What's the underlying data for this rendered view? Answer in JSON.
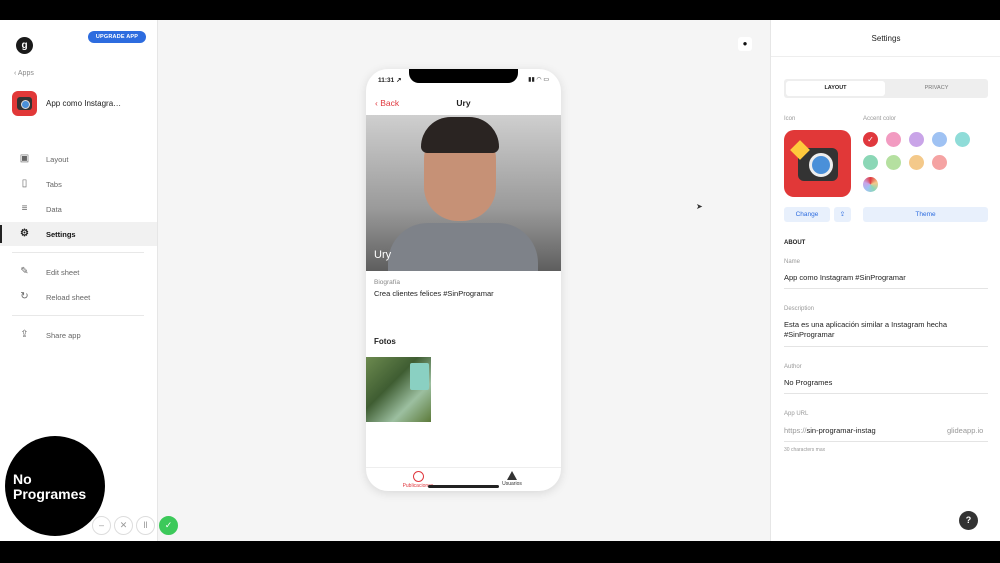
{
  "sidebar": {
    "logo_letter": "g",
    "upgrade_label": "UPGRADE APP",
    "apps_back": "‹ Apps",
    "app_name": "App como Instagra…",
    "nav": [
      {
        "label": "Layout",
        "icon": "layout-icon",
        "glyph": "▣"
      },
      {
        "label": "Tabs",
        "icon": "phone-icon",
        "glyph": "▯"
      },
      {
        "label": "Data",
        "icon": "database-icon",
        "glyph": "≡"
      },
      {
        "label": "Settings",
        "icon": "gear-icon",
        "glyph": "⚙"
      },
      {
        "label": "Edit sheet",
        "icon": "pencil-icon",
        "glyph": "✎"
      },
      {
        "label": "Reload sheet",
        "icon": "reload-icon",
        "glyph": "↻"
      },
      {
        "label": "Share app",
        "icon": "share-icon",
        "glyph": "⇪"
      }
    ]
  },
  "watermark": {
    "line1": "No",
    "line2": "Programes"
  },
  "controls": {
    "minus": "–",
    "close": "✕",
    "pause": "ll",
    "ok": "✓"
  },
  "preview": {
    "apple_glyph": "●",
    "status_time": "11:31 ↗",
    "status_icons": "▮▮ ◠ ▭",
    "back_label": "‹ Back",
    "title": "Ury",
    "photo_name": "Ury",
    "bio_label": "Biografía",
    "bio_text": "Crea clientes felices #SinProgramar",
    "photos_heading": "Fotos",
    "tabs": [
      {
        "label": "Publicaciones",
        "active": true
      },
      {
        "label": "Usuarios",
        "active": false
      }
    ]
  },
  "settings": {
    "title": "Settings",
    "seg_layout": "LAYOUT",
    "seg_privacy": "PRIVACY",
    "icon_label": "Icon",
    "accent_label": "Accent color",
    "accent_colors": [
      "#e0383e",
      "#f29bc1",
      "#c9a4e8",
      "#9fc2f3",
      "#8fdcd8",
      "#8bd7b6",
      "#b5e0a0",
      "#f4c98a",
      "#f5a3a3"
    ],
    "change_label": "Change",
    "theme_label": "Theme",
    "about_heading": "ABOUT",
    "name_label": "Name",
    "name_value": "App como Instagram #SinProgramar",
    "description_label": "Description",
    "description_value": "Esta es una aplicación similar a Instagram hecha #SinProgramar",
    "author_label": "Author",
    "author_value": "No Programes",
    "url_label": "App URL",
    "url_prefix": "https://",
    "url_value": "sin-programar-instag",
    "url_suffix": "glideapp.io",
    "url_hint": "30 characters max",
    "help": "?"
  }
}
